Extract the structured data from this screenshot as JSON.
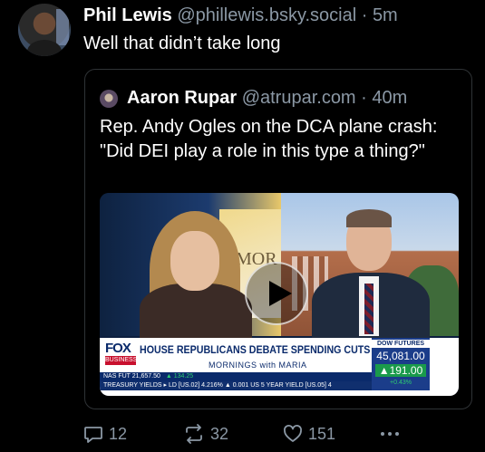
{
  "post": {
    "author_name": "Phil Lewis",
    "handle": "@phillewis.bsky.social",
    "separator": " · ",
    "time": "5m",
    "text": "Well that didn’t take long"
  },
  "quote": {
    "author_name": "Aaron Rupar",
    "handle": "@atrupar.com",
    "separator": " · ",
    "time": "40m",
    "text": "Rep. Andy Ogles on the DCA plane crash: \"Did DEI play a role in this type a thing?\""
  },
  "video": {
    "studio_text": "MOR",
    "fox_top": "FOX",
    "fox_bottom": "BUSINESS",
    "headline": "HOUSE REPUBLICANS DEBATE SPENDING CUTS",
    "show_logo": "MORNINGS with MARIA",
    "ticker1_prefix": "NAS FUT  21,657.50",
    "ticker1_change": "▲ 134.25",
    "ticker2": "TREASURY YIELDS ▸ LD [US.02] 4.216% ▲ 0.001  US 5 YEAR YIELD [US.05] 4",
    "dow_label": "DOW FUTURES",
    "dow_value": "45,081.00",
    "dow_change": "▲191.00",
    "dow_pct": "+0.43%"
  },
  "actions": {
    "replies": "12",
    "reposts": "32",
    "likes": "151"
  },
  "icons": {
    "reply": "reply-icon",
    "repost": "repost-icon",
    "like": "heart-icon",
    "more": "more-icon",
    "play": "play-icon"
  },
  "colors": {
    "background": "#000000",
    "muted": "#8b98a5",
    "border": "#2f3336"
  }
}
